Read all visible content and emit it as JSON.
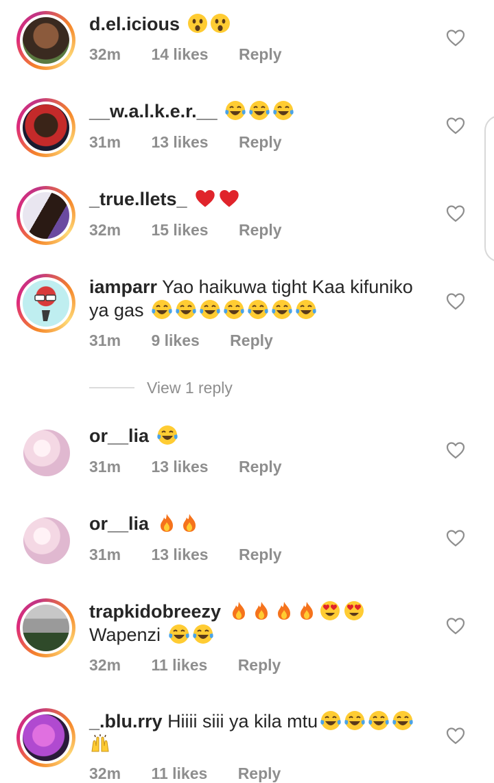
{
  "comments": [
    {
      "username": "d.el.icious",
      "text": "",
      "emojis": [
        "astonished",
        "astonished"
      ],
      "time": "32m",
      "likes": "14 likes",
      "reply": "Reply",
      "avatar": "avatar-girl-braids",
      "ring": true,
      "tone": [
        "#3a2a20",
        "#8b5a3c",
        "#5a7a40"
      ]
    },
    {
      "username": "__w.a.l.k.e.r.__",
      "text": "",
      "emojis": [
        "joy",
        "joy",
        "joy"
      ],
      "time": "31m",
      "likes": "13 likes",
      "reply": "Reply",
      "avatar": "avatar-man-red",
      "ring": true,
      "tone": [
        "#c42a2a",
        "#3a2418",
        "#1a1a2e"
      ]
    },
    {
      "username": "_true.llets_",
      "text": "",
      "emojis": [
        "heart",
        "heart"
      ],
      "time": "32m",
      "likes": "15 likes",
      "reply": "Reply",
      "avatar": "avatar-couple",
      "ring": true,
      "tone": [
        "#e9e6f0",
        "#2a1a14",
        "#6a4aa0"
      ]
    },
    {
      "username": "iamparr",
      "text": "Yao haikuwa tight Kaa kifuniko",
      "text2": "ya gas",
      "emojis": [],
      "emojis2": [
        "joy",
        "joy",
        "joy",
        "joy",
        "joy",
        "joy",
        "joy"
      ],
      "time": "31m",
      "likes": "9 likes",
      "reply": "Reply",
      "avatar": "avatar-cartoon",
      "ring": true,
      "tone": [
        "#bfeef0",
        "#d83a3a",
        "#3a3a3a"
      ]
    },
    {
      "username": "or__lia",
      "text": "",
      "emojis": [
        "joy"
      ],
      "time": "31m",
      "likes": "13 likes",
      "reply": "Reply",
      "avatar": "avatar-flowers",
      "ring": false,
      "tone": [
        "#f4d8e4",
        "#e0b8d0",
        "#fff2f6"
      ]
    },
    {
      "username": "or__lia",
      "text": "",
      "emojis": [
        "fire",
        "fire"
      ],
      "time": "31m",
      "likes": "13 likes",
      "reply": "Reply",
      "avatar": "avatar-flowers",
      "ring": false,
      "tone": [
        "#f4d8e4",
        "#e0b8d0",
        "#fff2f6"
      ]
    },
    {
      "username": "trapkidobreezy",
      "text": "",
      "emojis": [
        "fire",
        "fire",
        "fire",
        "fire",
        "heart-eyes",
        "heart-eyes"
      ],
      "text2": "Wapenzi",
      "emojis2": [
        "joy",
        "joy"
      ],
      "time": "32m",
      "likes": "11 likes",
      "reply": "Reply",
      "avatar": "avatar-man-street",
      "ring": true,
      "tone": [
        "#9a9a9a",
        "#2f4a2a",
        "#c7c7c7"
      ]
    },
    {
      "username": "_.blu.rry",
      "text": "Hiiii siii ya kila mtu",
      "emojis": [
        "joy",
        "joy",
        "joy",
        "joy"
      ],
      "emojis2": [
        "raised-hands"
      ],
      "time": "32m",
      "likes": "11 likes",
      "reply": "Reply",
      "avatar": "avatar-girl-purple",
      "ring": true,
      "tone": [
        "#b04ad0",
        "#e070e0",
        "#2a1a3a"
      ]
    }
  ],
  "view_replies": "View 1 reply",
  "icons": {
    "like": "heart-outline-icon"
  }
}
